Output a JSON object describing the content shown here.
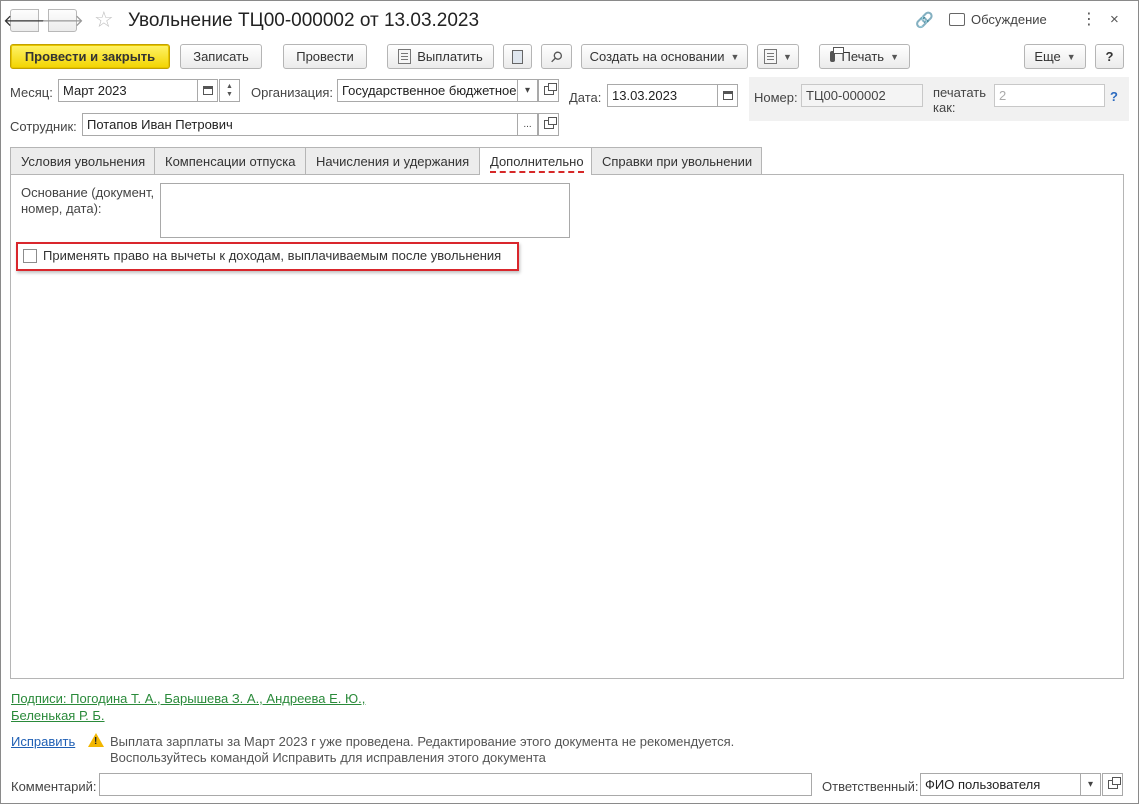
{
  "window": {
    "title": "Увольнение ТЦ00-000002 от 13.03.2023",
    "discussion_label": "Обсуждение",
    "back_glyph": "🡐",
    "forward_glyph": "🡒",
    "star_glyph": "☆",
    "link_glyph": "🔗",
    "kebab_glyph": "⋮",
    "close_glyph": "×"
  },
  "toolbar": {
    "post_and_close": "Провести и закрыть",
    "save": "Записать",
    "post": "Провести",
    "pay": "Выплатить",
    "create_based_on": "Создать на основании",
    "print": "Печать",
    "more": "Еще",
    "help": "?"
  },
  "header": {
    "month_label": "Месяц:",
    "month_value": "Март 2023",
    "org_label": "Организация:",
    "org_value": "Государственное бюджетное",
    "date_label": "Дата:",
    "date_value": "13.03.2023",
    "number_label": "Номер:",
    "number_value": "ТЦ00-000002",
    "print_as_label_1": "печатать",
    "print_as_label_2": "как:",
    "print_as_value": "2",
    "print_as_help": "?",
    "employee_label": "Сотрудник:",
    "employee_value": "Потапов Иван Петрович",
    "ellipsis": "..."
  },
  "tabs": [
    {
      "label": "Условия увольнения"
    },
    {
      "label": "Компенсации отпуска"
    },
    {
      "label": "Начисления и удержания"
    },
    {
      "label": "Дополнительно",
      "active": true
    },
    {
      "label": "Справки при увольнении"
    }
  ],
  "additional": {
    "basis_label_1": "Основание (документ,",
    "basis_label_2": "номер, дата):",
    "basis_value": "",
    "apply_deductions_label": "Применять право на вычеты к доходам, выплачиваемым после увольнения",
    "apply_deductions_checked": false
  },
  "footer": {
    "signatures_line1": "Подписи: Погодина Т. А., Барышева З. А., Андреева Е. Ю.,",
    "signatures_line2": "Беленькая Р. Б.",
    "fix_link": "Исправить",
    "warning_line1": "Выплата зарплаты за Март 2023 г уже проведена. Редактирование этого документа не рекомендуется.",
    "warning_line2": "Воспользуйтесь командой Исправить для исправления этого документа",
    "comment_label": "Комментарий:",
    "comment_value": "",
    "responsible_label": "Ответственный:",
    "responsible_value": "ФИО пользователя"
  }
}
